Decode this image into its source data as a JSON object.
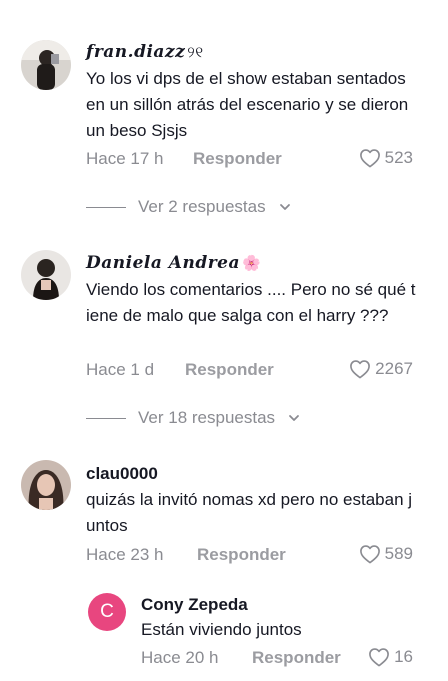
{
  "comments": [
    {
      "username": "fran.diazz",
      "badge": "୨୧",
      "text": "Yo los vi dps de el show estaban sentados en un sillón atrás del escenario y se dieron un beso Sjsjs",
      "time": "Hace 17 h",
      "reply": "Responder",
      "likes": "523",
      "view_replies": "Ver 2 respuestas"
    },
    {
      "username": "Daniela Andrea",
      "badge": "🌸",
      "text": "Viendo los comentarios .... Pero no sé qué tiene de malo que salga con el harry ???",
      "time": "Hace 1 d",
      "reply": "Responder",
      "likes": "2267",
      "view_replies": "Ver 18 respuestas"
    },
    {
      "username": "clau0000",
      "text": "quizás la invitó nomas xd pero no estaban juntos",
      "time": "Hace 23 h",
      "reply": "Responder",
      "likes": "589"
    }
  ],
  "reply": {
    "avatar_letter": "C",
    "username": "Cony Zepeda",
    "text": "Están viviendo juntos",
    "time": "Hace 20 h",
    "reply": "Responder",
    "likes": "16"
  },
  "colors": {
    "muted": "#8a8b91",
    "text": "#161823",
    "avatar_pink": "#e8467f"
  }
}
